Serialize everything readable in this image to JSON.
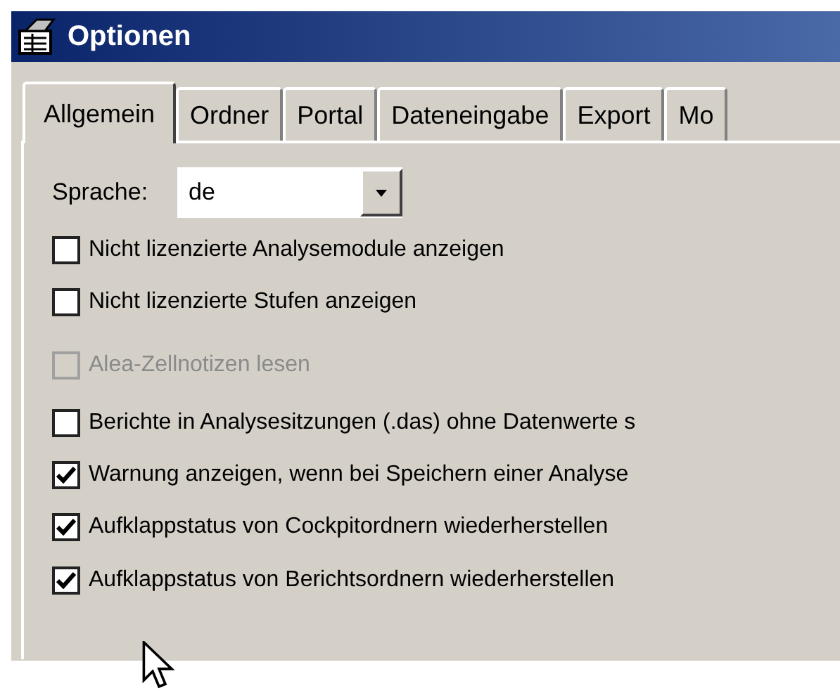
{
  "window": {
    "title": "Optionen"
  },
  "tabs": [
    {
      "label": "Allgemein",
      "selected": true
    },
    {
      "label": "Ordner",
      "selected": false
    },
    {
      "label": "Portal",
      "selected": false
    },
    {
      "label": "Dateneingabe",
      "selected": false
    },
    {
      "label": "Export",
      "selected": false
    },
    {
      "label": "Mo",
      "selected": false
    }
  ],
  "language": {
    "label": "Sprache:",
    "value": "de"
  },
  "options": [
    {
      "label": "Nicht lizenzierte Analysemodule anzeigen",
      "checked": false,
      "disabled": false
    },
    {
      "label": "Nicht lizenzierte Stufen anzeigen",
      "checked": false,
      "disabled": false
    },
    {
      "label": "Alea-Zellnotizen lesen",
      "checked": false,
      "disabled": true
    },
    {
      "label": "Berichte in Analysesitzungen (.das) ohne Datenwerte s",
      "checked": false,
      "disabled": false
    },
    {
      "label": "Warnung anzeigen, wenn bei Speichern einer Analyse",
      "checked": true,
      "disabled": false
    },
    {
      "label": "Aufklappstatus von Cockpitordnern wiederherstellen",
      "checked": true,
      "disabled": false
    },
    {
      "label": "Aufklappstatus von Berichtsordnern wiederherstellen",
      "checked": true,
      "disabled": false
    }
  ]
}
